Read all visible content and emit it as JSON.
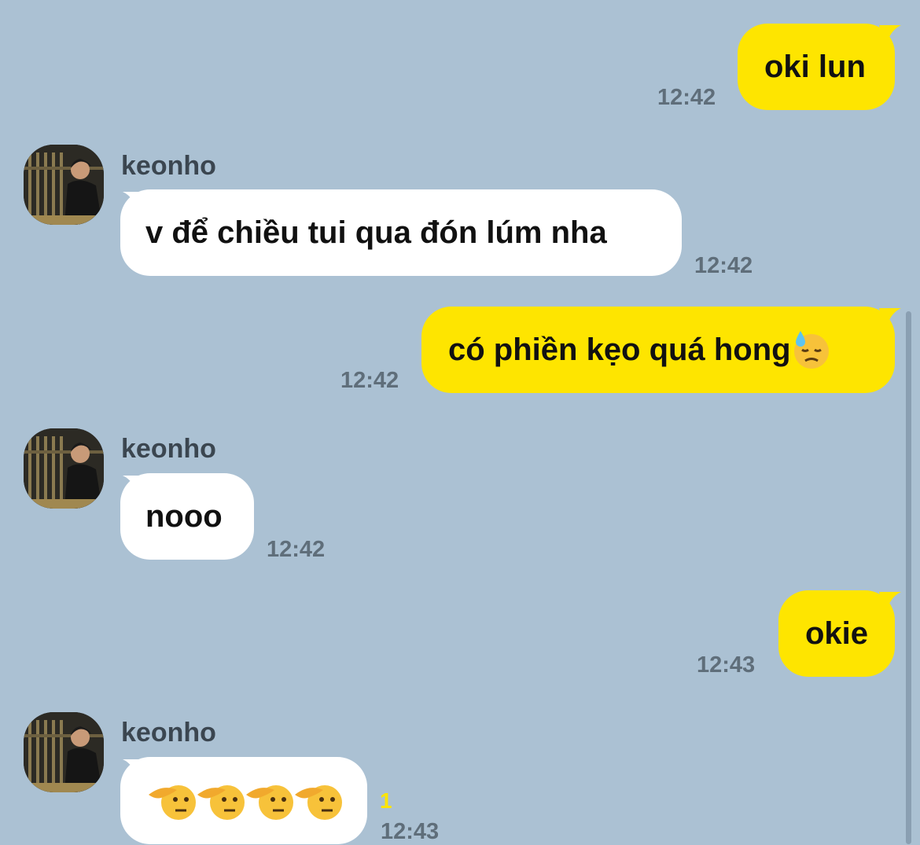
{
  "messages": [
    {
      "side": "mine",
      "text": "oki lun",
      "time": "12:42"
    },
    {
      "side": "theirs",
      "sender": "keonho",
      "text": "v để chiều tui qua đón lúm nha",
      "time": "12:42"
    },
    {
      "side": "mine",
      "text": "có phiền kẹo quá hong",
      "emoji": "downcast-face-with-sweat",
      "time": "12:42"
    },
    {
      "side": "theirs",
      "sender": "keonho",
      "text": "nooo",
      "time": "12:42"
    },
    {
      "side": "mine",
      "text": "okie",
      "time": "12:43"
    },
    {
      "side": "theirs",
      "sender": "keonho",
      "emoji": "saluting-face x4",
      "time": "12:43",
      "unread": "1"
    }
  ],
  "colors": {
    "background": "#abc1d3",
    "my_bubble": "#fee500",
    "their_bubble": "#ffffff"
  }
}
